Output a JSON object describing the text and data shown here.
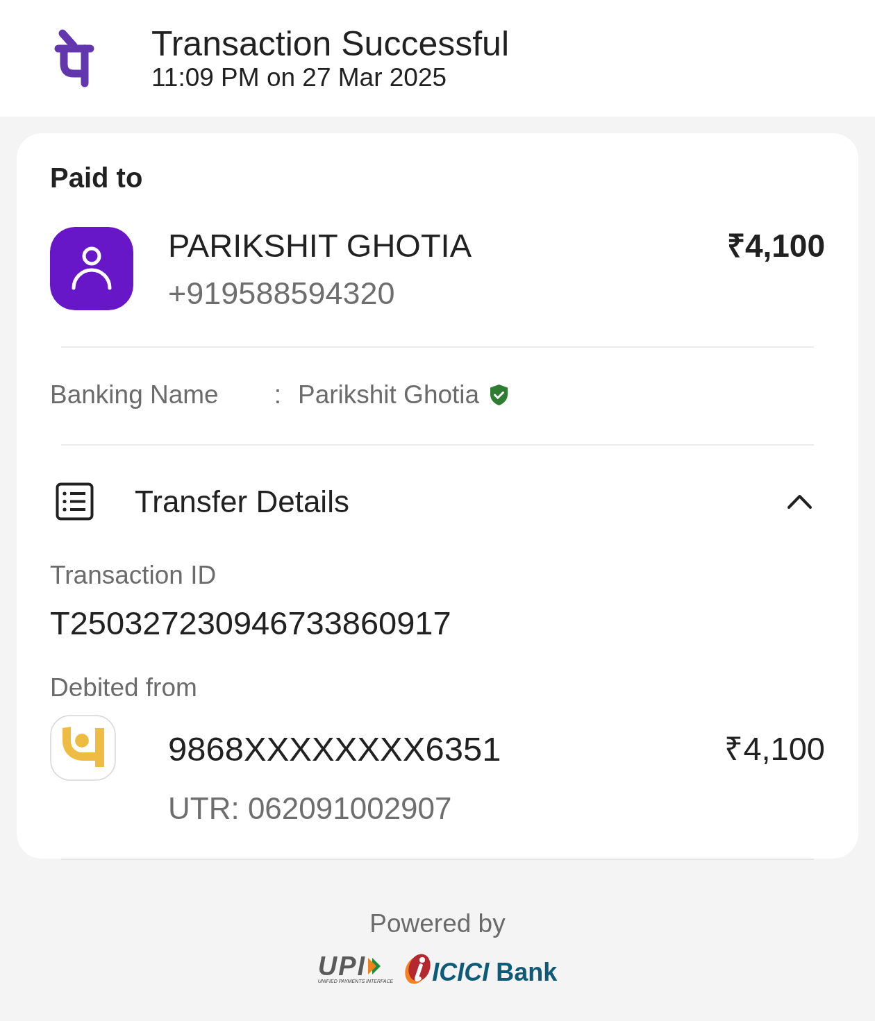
{
  "header": {
    "title": "Transaction Successful",
    "timestamp": "11:09 PM on 27 Mar 2025"
  },
  "paid_to": {
    "heading": "Paid to",
    "name": "PARIKSHIT GHOTIA",
    "phone": "+919588594320",
    "amount": "₹4,100"
  },
  "banking_name": {
    "label": "Banking Name",
    "separator": ":",
    "value": "Parikshit Ghotia",
    "verified": true
  },
  "transfer_details": {
    "title": "Transfer Details",
    "expanded": true,
    "transaction_id": {
      "label": "Transaction ID",
      "value": "T250327230946733860917"
    },
    "debited_from": {
      "label": "Debited from",
      "account": "9868XXXXXXXX6351",
      "amount": "₹4,100",
      "utr": "UTR: 062091002907"
    }
  },
  "footer": {
    "powered_by": "Powered by",
    "upi_logo": {
      "text": "UPI",
      "caption": "UNIFIED PAYMENTS INTERFACE"
    },
    "bank_logo": "*ICICI* Bank"
  }
}
